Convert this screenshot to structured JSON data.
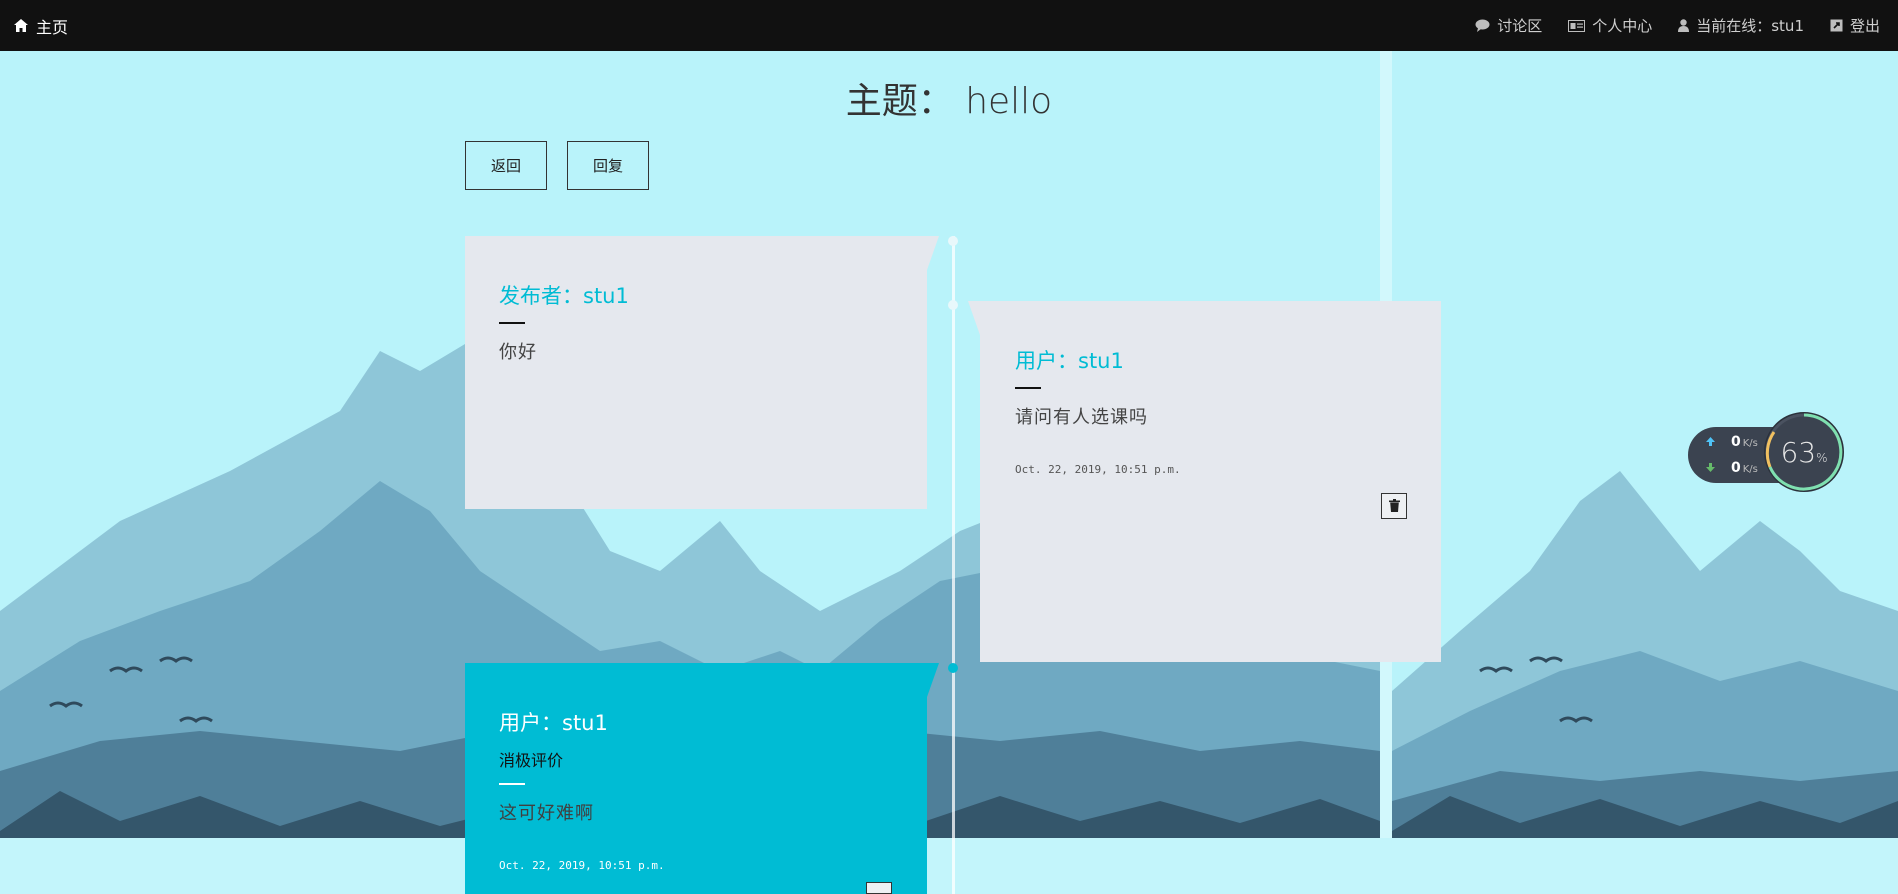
{
  "nav": {
    "home": "主页",
    "discussion": "讨论区",
    "profile": "个人中心",
    "online": "当前在线：stu1",
    "logout": "登出"
  },
  "page": {
    "title": "主题：  hello",
    "back_button": "返回",
    "reply_button": "回复"
  },
  "posts": [
    {
      "heading": "发布者：stu1",
      "body": "你好"
    },
    {
      "heading": "用户：stu1",
      "body": "请问有人选课吗",
      "time": "Oct. 22, 2019, 10:51 p.m."
    },
    {
      "heading": "用户：stu1",
      "sub": "消极评价",
      "body": "这可好难啊",
      "time": "Oct. 22, 2019, 10:51 p.m."
    }
  ],
  "speed_widget": {
    "up": "0",
    "down": "0",
    "unit": "K/s",
    "percent": "63",
    "percent_sign": "%"
  },
  "colors": {
    "accent": "#00bcd4",
    "navbar": "#111111",
    "background": "#b9f3fa",
    "card": "#e5e8ee"
  }
}
